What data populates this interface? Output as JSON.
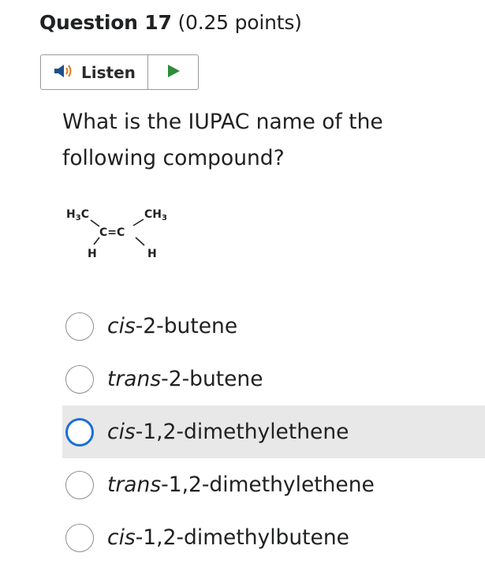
{
  "question": {
    "number_label": "Question 17",
    "points_label": "(0.25 points)",
    "prompt": "What is the IUPAC name of the following compound?"
  },
  "listen": {
    "label": "Listen",
    "speaker_icon": "speaker-icon",
    "play_icon": "play-icon",
    "speaker_color": "#1f4f8b",
    "play_color": "#2e8b3a"
  },
  "molecule": {
    "top_left": "H3C",
    "top_right": "CH3",
    "center": "C=C",
    "bottom_left": "H",
    "bottom_right": "H"
  },
  "options": [
    {
      "prefix": "cis",
      "suffix": "-2-butene",
      "selected_highlight": false
    },
    {
      "prefix": "trans",
      "suffix": "-2-butene",
      "selected_highlight": false
    },
    {
      "prefix": "cis",
      "suffix": "-1,2-dimethylethene",
      "selected_highlight": true
    },
    {
      "prefix": "trans",
      "suffix": "-1,2-dimethylethene",
      "selected_highlight": false
    },
    {
      "prefix": "cis",
      "suffix": "-1,2-dimethylbutene",
      "selected_highlight": false
    }
  ],
  "colors": {
    "focus_ring": "#1c6fd1",
    "highlight_bg": "#e8e8e8"
  }
}
